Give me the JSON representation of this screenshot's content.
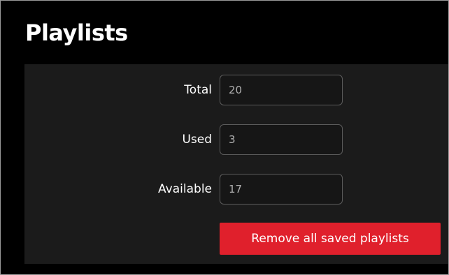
{
  "header": {
    "title": "Playlists"
  },
  "fields": [
    {
      "label": "Total",
      "value": "20"
    },
    {
      "label": "Used",
      "value": "3"
    },
    {
      "label": "Available",
      "value": "17"
    }
  ],
  "actions": {
    "remove_all_label": "Remove all saved playlists"
  },
  "colors": {
    "background": "#000000",
    "panel": "#1b1b1b",
    "accent_button": "#e0202c",
    "text": "#ffffff"
  }
}
